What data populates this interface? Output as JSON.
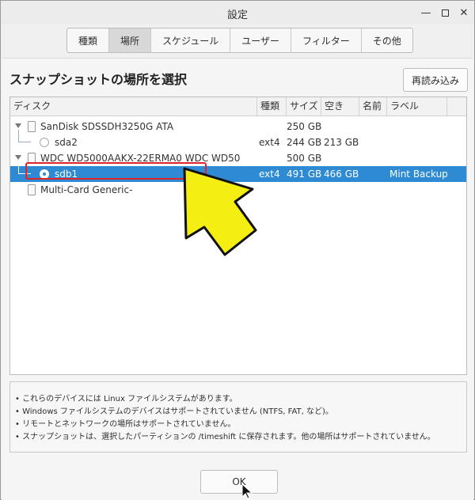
{
  "window": {
    "title": "設定"
  },
  "tabs": [
    "種類",
    "場所",
    "スケジュール",
    "ユーザー",
    "フィルター",
    "その他"
  ],
  "active_tab": 1,
  "heading": "スナップショットの場所を選択",
  "reload_label": "再読み込み",
  "columns": {
    "disk": "ディスク",
    "type": "種類",
    "size": "サイズ",
    "free": "空き",
    "name": "名前",
    "label": "ラベル"
  },
  "rows": [
    {
      "name": "SanDisk SDSSDH3250G ATA",
      "type": "",
      "size": "250 GB",
      "free": "",
      "label": ""
    },
    {
      "name": "sda2",
      "type": "ext4",
      "size": "244 GB",
      "free": "213 GB",
      "label": ""
    },
    {
      "name": "WDC WD5000AAKX-22ERMA0 WDC WD50",
      "type": "",
      "size": "500 GB",
      "free": "",
      "label": ""
    },
    {
      "name": "sdb1",
      "type": "ext4",
      "size": "491 GB",
      "free": "466 GB",
      "label": "Mint Backup"
    },
    {
      "name": "Multi-Card Generic-",
      "type": "",
      "size": "",
      "free": "",
      "label": ""
    }
  ],
  "notes": [
    "• これらのデバイスには Linux ファイルシステムがあります。",
    "• Windows ファイルシステムのデバイスはサポートされていません (NTFS, FAT, など)。",
    "• リモートとネットワークの場所はサポートされていません。",
    "• スナップショットは、選択したパーティションの /timeshift に保存されます。他の場所はサポートされていません。"
  ],
  "ok_label": "OK",
  "colors": {
    "selection": "#2e8bd3",
    "highlight_box": "#e0242c",
    "arrow_fill": "#f5ee12"
  },
  "icons": {
    "expander": "triangle-down-icon",
    "disk": "disk-icon",
    "partition": "radio-icon"
  }
}
